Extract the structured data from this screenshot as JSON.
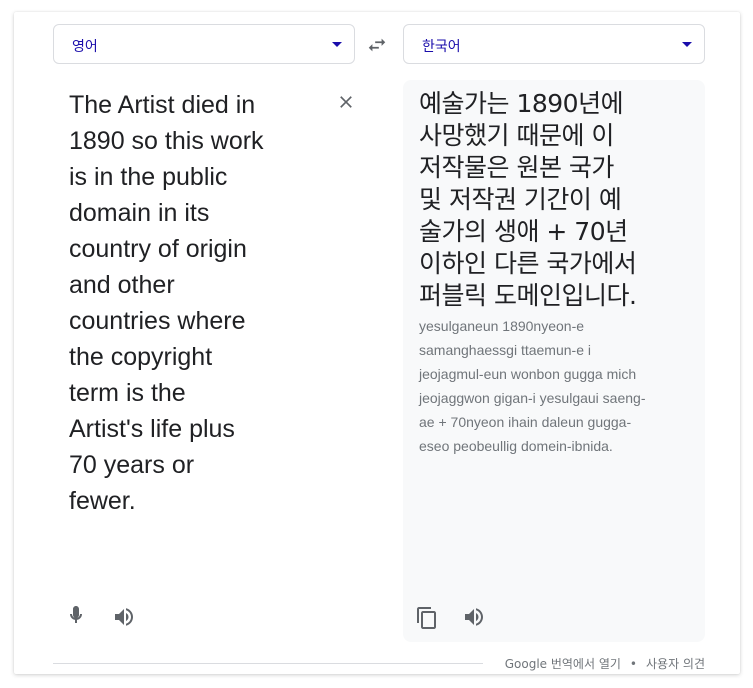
{
  "source_lang": {
    "label": "영어"
  },
  "target_lang": {
    "label": "한국어"
  },
  "source_text": "The Artist died in\n1890 so this work\nis in the public\ndomain in its\ncountry of origin\nand other\ncountries where\nthe copyright\nterm is the\nArtist's life plus\n70 years or\nfewer.",
  "translation": {
    "text": "예술가는 1890년에\n사망했기 때문에 이\n저작물은 원본 국가\n및 저작권 기간이 예\n술가의 생애 + 70년\n이하인 다른 국가에서\n퍼블릭 도메인입니다.",
    "romanization": "yesulganeun 1890nyeon-e\nsamanghaessgi ttaemun-e i\njeojagmul-eun wonbon gugga mich\njeojaggwon gigan-i yesulgaui saeng-\nae + 70nyeon ihain daleun gugga-\neseo peobeullig domein-ibnida."
  },
  "icons": {
    "swap": "swap-icon",
    "clear": "close-icon",
    "mic": "microphone-icon",
    "speak_source": "speaker-icon",
    "copy": "copy-icon",
    "speak_target": "speaker-icon"
  },
  "footer": {
    "open_link": "Google 번역에서 열기",
    "separator": "•",
    "feedback": "사용자 의견"
  },
  "colors": {
    "accent": "#1a0dab",
    "icon": "#5f6368",
    "panel_bg": "#f8f9fa",
    "secondary_text": "#70757a"
  }
}
